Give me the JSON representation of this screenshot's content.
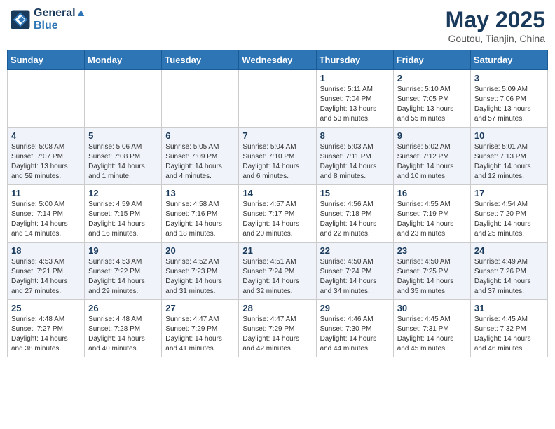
{
  "header": {
    "logo_line1": "General",
    "logo_line2": "Blue",
    "main_title": "May 2025",
    "subtitle": "Goutou, Tianjin, China"
  },
  "days_of_week": [
    "Sunday",
    "Monday",
    "Tuesday",
    "Wednesday",
    "Thursday",
    "Friday",
    "Saturday"
  ],
  "weeks": [
    [
      {
        "day": "",
        "info": ""
      },
      {
        "day": "",
        "info": ""
      },
      {
        "day": "",
        "info": ""
      },
      {
        "day": "",
        "info": ""
      },
      {
        "day": "1",
        "info": "Sunrise: 5:11 AM\nSunset: 7:04 PM\nDaylight: 13 hours\nand 53 minutes."
      },
      {
        "day": "2",
        "info": "Sunrise: 5:10 AM\nSunset: 7:05 PM\nDaylight: 13 hours\nand 55 minutes."
      },
      {
        "day": "3",
        "info": "Sunrise: 5:09 AM\nSunset: 7:06 PM\nDaylight: 13 hours\nand 57 minutes."
      }
    ],
    [
      {
        "day": "4",
        "info": "Sunrise: 5:08 AM\nSunset: 7:07 PM\nDaylight: 13 hours\nand 59 minutes."
      },
      {
        "day": "5",
        "info": "Sunrise: 5:06 AM\nSunset: 7:08 PM\nDaylight: 14 hours\nand 1 minute."
      },
      {
        "day": "6",
        "info": "Sunrise: 5:05 AM\nSunset: 7:09 PM\nDaylight: 14 hours\nand 4 minutes."
      },
      {
        "day": "7",
        "info": "Sunrise: 5:04 AM\nSunset: 7:10 PM\nDaylight: 14 hours\nand 6 minutes."
      },
      {
        "day": "8",
        "info": "Sunrise: 5:03 AM\nSunset: 7:11 PM\nDaylight: 14 hours\nand 8 minutes."
      },
      {
        "day": "9",
        "info": "Sunrise: 5:02 AM\nSunset: 7:12 PM\nDaylight: 14 hours\nand 10 minutes."
      },
      {
        "day": "10",
        "info": "Sunrise: 5:01 AM\nSunset: 7:13 PM\nDaylight: 14 hours\nand 12 minutes."
      }
    ],
    [
      {
        "day": "11",
        "info": "Sunrise: 5:00 AM\nSunset: 7:14 PM\nDaylight: 14 hours\nand 14 minutes."
      },
      {
        "day": "12",
        "info": "Sunrise: 4:59 AM\nSunset: 7:15 PM\nDaylight: 14 hours\nand 16 minutes."
      },
      {
        "day": "13",
        "info": "Sunrise: 4:58 AM\nSunset: 7:16 PM\nDaylight: 14 hours\nand 18 minutes."
      },
      {
        "day": "14",
        "info": "Sunrise: 4:57 AM\nSunset: 7:17 PM\nDaylight: 14 hours\nand 20 minutes."
      },
      {
        "day": "15",
        "info": "Sunrise: 4:56 AM\nSunset: 7:18 PM\nDaylight: 14 hours\nand 22 minutes."
      },
      {
        "day": "16",
        "info": "Sunrise: 4:55 AM\nSunset: 7:19 PM\nDaylight: 14 hours\nand 23 minutes."
      },
      {
        "day": "17",
        "info": "Sunrise: 4:54 AM\nSunset: 7:20 PM\nDaylight: 14 hours\nand 25 minutes."
      }
    ],
    [
      {
        "day": "18",
        "info": "Sunrise: 4:53 AM\nSunset: 7:21 PM\nDaylight: 14 hours\nand 27 minutes."
      },
      {
        "day": "19",
        "info": "Sunrise: 4:53 AM\nSunset: 7:22 PM\nDaylight: 14 hours\nand 29 minutes."
      },
      {
        "day": "20",
        "info": "Sunrise: 4:52 AM\nSunset: 7:23 PM\nDaylight: 14 hours\nand 31 minutes."
      },
      {
        "day": "21",
        "info": "Sunrise: 4:51 AM\nSunset: 7:24 PM\nDaylight: 14 hours\nand 32 minutes."
      },
      {
        "day": "22",
        "info": "Sunrise: 4:50 AM\nSunset: 7:24 PM\nDaylight: 14 hours\nand 34 minutes."
      },
      {
        "day": "23",
        "info": "Sunrise: 4:50 AM\nSunset: 7:25 PM\nDaylight: 14 hours\nand 35 minutes."
      },
      {
        "day": "24",
        "info": "Sunrise: 4:49 AM\nSunset: 7:26 PM\nDaylight: 14 hours\nand 37 minutes."
      }
    ],
    [
      {
        "day": "25",
        "info": "Sunrise: 4:48 AM\nSunset: 7:27 PM\nDaylight: 14 hours\nand 38 minutes."
      },
      {
        "day": "26",
        "info": "Sunrise: 4:48 AM\nSunset: 7:28 PM\nDaylight: 14 hours\nand 40 minutes."
      },
      {
        "day": "27",
        "info": "Sunrise: 4:47 AM\nSunset: 7:29 PM\nDaylight: 14 hours\nand 41 minutes."
      },
      {
        "day": "28",
        "info": "Sunrise: 4:47 AM\nSunset: 7:29 PM\nDaylight: 14 hours\nand 42 minutes."
      },
      {
        "day": "29",
        "info": "Sunrise: 4:46 AM\nSunset: 7:30 PM\nDaylight: 14 hours\nand 44 minutes."
      },
      {
        "day": "30",
        "info": "Sunrise: 4:45 AM\nSunset: 7:31 PM\nDaylight: 14 hours\nand 45 minutes."
      },
      {
        "day": "31",
        "info": "Sunrise: 4:45 AM\nSunset: 7:32 PM\nDaylight: 14 hours\nand 46 minutes."
      }
    ]
  ]
}
